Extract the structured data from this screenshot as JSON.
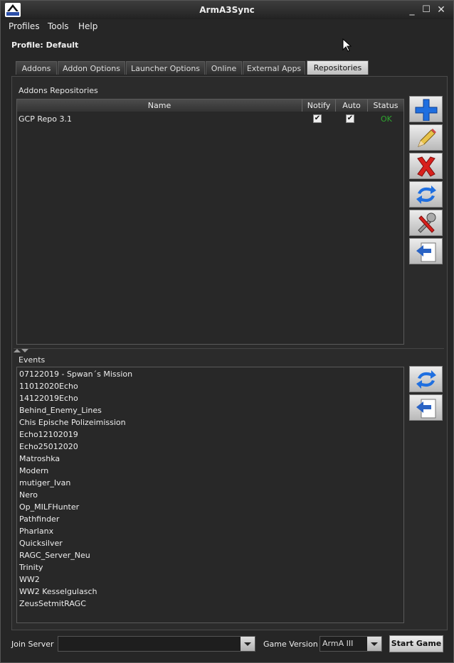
{
  "window": {
    "title": "ArmA3Sync",
    "minimize": "_",
    "maximize": "☐",
    "close": "✕"
  },
  "menu": {
    "profiles": "Profiles",
    "tools": "Tools",
    "help": "Help"
  },
  "profile_label": "Profile: Default",
  "tabs": [
    {
      "label": "Addons"
    },
    {
      "label": "Addon Options"
    },
    {
      "label": "Launcher Options"
    },
    {
      "label": "Online"
    },
    {
      "label": "External Apps"
    },
    {
      "label": "Repositories",
      "active": true
    }
  ],
  "repositories": {
    "section_label": "Addons Repositories",
    "columns": {
      "name": "Name",
      "notify": "Notify",
      "auto": "Auto",
      "status": "Status"
    },
    "rows": [
      {
        "name": "GCP Repo 3.1",
        "notify": true,
        "auto": true,
        "status": "OK"
      }
    ],
    "actions": [
      "add-icon",
      "edit-icon",
      "delete-icon",
      "sync-icon",
      "settings-icon",
      "upload-icon"
    ]
  },
  "events": {
    "section_label": "Events",
    "items": [
      "07122019 - Spwan´s Mission",
      "11012020Echo",
      "14122019Echo",
      "Behind_Enemy_Lines",
      "Chis Epische Polizeimission",
      "Echo12102019",
      "Echo25012020",
      "Matroshka",
      "Modern",
      "mutiger_Ivan",
      "Nero",
      "Op_MILFHunter",
      "Pathfinder",
      "Pharlanx",
      "Quicksilver",
      "RAGC_Server_Neu",
      "Trinity",
      "WW2",
      "WW2 Kesselgulasch",
      "ZeusSetmitRAGC"
    ],
    "actions": [
      "sync-icon",
      "upload-icon"
    ]
  },
  "bottom": {
    "join_server_label": "Join Server",
    "join_server_value": "",
    "game_version_label": "Game Version",
    "game_version_value": "ArmA III",
    "start_button": "Start Game"
  },
  "colors": {
    "status_ok": "#2ea52e",
    "add_blue": "#1f6fe0",
    "delete_red": "#d8201c"
  }
}
